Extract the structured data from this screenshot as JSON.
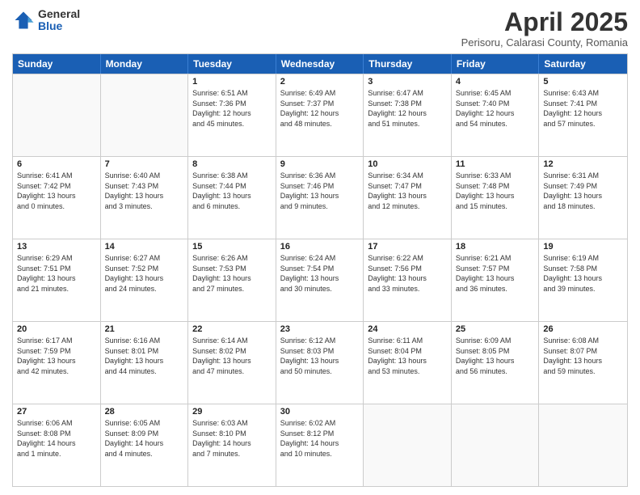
{
  "logo": {
    "general": "General",
    "blue": "Blue"
  },
  "header": {
    "title": "April 2025",
    "subtitle": "Perisoru, Calarasi County, Romania"
  },
  "days_of_week": [
    "Sunday",
    "Monday",
    "Tuesday",
    "Wednesday",
    "Thursday",
    "Friday",
    "Saturday"
  ],
  "rows": [
    [
      {
        "day": "",
        "lines": []
      },
      {
        "day": "",
        "lines": []
      },
      {
        "day": "1",
        "lines": [
          "Sunrise: 6:51 AM",
          "Sunset: 7:36 PM",
          "Daylight: 12 hours",
          "and 45 minutes."
        ]
      },
      {
        "day": "2",
        "lines": [
          "Sunrise: 6:49 AM",
          "Sunset: 7:37 PM",
          "Daylight: 12 hours",
          "and 48 minutes."
        ]
      },
      {
        "day": "3",
        "lines": [
          "Sunrise: 6:47 AM",
          "Sunset: 7:38 PM",
          "Daylight: 12 hours",
          "and 51 minutes."
        ]
      },
      {
        "day": "4",
        "lines": [
          "Sunrise: 6:45 AM",
          "Sunset: 7:40 PM",
          "Daylight: 12 hours",
          "and 54 minutes."
        ]
      },
      {
        "day": "5",
        "lines": [
          "Sunrise: 6:43 AM",
          "Sunset: 7:41 PM",
          "Daylight: 12 hours",
          "and 57 minutes."
        ]
      }
    ],
    [
      {
        "day": "6",
        "lines": [
          "Sunrise: 6:41 AM",
          "Sunset: 7:42 PM",
          "Daylight: 13 hours",
          "and 0 minutes."
        ]
      },
      {
        "day": "7",
        "lines": [
          "Sunrise: 6:40 AM",
          "Sunset: 7:43 PM",
          "Daylight: 13 hours",
          "and 3 minutes."
        ]
      },
      {
        "day": "8",
        "lines": [
          "Sunrise: 6:38 AM",
          "Sunset: 7:44 PM",
          "Daylight: 13 hours",
          "and 6 minutes."
        ]
      },
      {
        "day": "9",
        "lines": [
          "Sunrise: 6:36 AM",
          "Sunset: 7:46 PM",
          "Daylight: 13 hours",
          "and 9 minutes."
        ]
      },
      {
        "day": "10",
        "lines": [
          "Sunrise: 6:34 AM",
          "Sunset: 7:47 PM",
          "Daylight: 13 hours",
          "and 12 minutes."
        ]
      },
      {
        "day": "11",
        "lines": [
          "Sunrise: 6:33 AM",
          "Sunset: 7:48 PM",
          "Daylight: 13 hours",
          "and 15 minutes."
        ]
      },
      {
        "day": "12",
        "lines": [
          "Sunrise: 6:31 AM",
          "Sunset: 7:49 PM",
          "Daylight: 13 hours",
          "and 18 minutes."
        ]
      }
    ],
    [
      {
        "day": "13",
        "lines": [
          "Sunrise: 6:29 AM",
          "Sunset: 7:51 PM",
          "Daylight: 13 hours",
          "and 21 minutes."
        ]
      },
      {
        "day": "14",
        "lines": [
          "Sunrise: 6:27 AM",
          "Sunset: 7:52 PM",
          "Daylight: 13 hours",
          "and 24 minutes."
        ]
      },
      {
        "day": "15",
        "lines": [
          "Sunrise: 6:26 AM",
          "Sunset: 7:53 PM",
          "Daylight: 13 hours",
          "and 27 minutes."
        ]
      },
      {
        "day": "16",
        "lines": [
          "Sunrise: 6:24 AM",
          "Sunset: 7:54 PM",
          "Daylight: 13 hours",
          "and 30 minutes."
        ]
      },
      {
        "day": "17",
        "lines": [
          "Sunrise: 6:22 AM",
          "Sunset: 7:56 PM",
          "Daylight: 13 hours",
          "and 33 minutes."
        ]
      },
      {
        "day": "18",
        "lines": [
          "Sunrise: 6:21 AM",
          "Sunset: 7:57 PM",
          "Daylight: 13 hours",
          "and 36 minutes."
        ]
      },
      {
        "day": "19",
        "lines": [
          "Sunrise: 6:19 AM",
          "Sunset: 7:58 PM",
          "Daylight: 13 hours",
          "and 39 minutes."
        ]
      }
    ],
    [
      {
        "day": "20",
        "lines": [
          "Sunrise: 6:17 AM",
          "Sunset: 7:59 PM",
          "Daylight: 13 hours",
          "and 42 minutes."
        ]
      },
      {
        "day": "21",
        "lines": [
          "Sunrise: 6:16 AM",
          "Sunset: 8:01 PM",
          "Daylight: 13 hours",
          "and 44 minutes."
        ]
      },
      {
        "day": "22",
        "lines": [
          "Sunrise: 6:14 AM",
          "Sunset: 8:02 PM",
          "Daylight: 13 hours",
          "and 47 minutes."
        ]
      },
      {
        "day": "23",
        "lines": [
          "Sunrise: 6:12 AM",
          "Sunset: 8:03 PM",
          "Daylight: 13 hours",
          "and 50 minutes."
        ]
      },
      {
        "day": "24",
        "lines": [
          "Sunrise: 6:11 AM",
          "Sunset: 8:04 PM",
          "Daylight: 13 hours",
          "and 53 minutes."
        ]
      },
      {
        "day": "25",
        "lines": [
          "Sunrise: 6:09 AM",
          "Sunset: 8:05 PM",
          "Daylight: 13 hours",
          "and 56 minutes."
        ]
      },
      {
        "day": "26",
        "lines": [
          "Sunrise: 6:08 AM",
          "Sunset: 8:07 PM",
          "Daylight: 13 hours",
          "and 59 minutes."
        ]
      }
    ],
    [
      {
        "day": "27",
        "lines": [
          "Sunrise: 6:06 AM",
          "Sunset: 8:08 PM",
          "Daylight: 14 hours",
          "and 1 minute."
        ]
      },
      {
        "day": "28",
        "lines": [
          "Sunrise: 6:05 AM",
          "Sunset: 8:09 PM",
          "Daylight: 14 hours",
          "and 4 minutes."
        ]
      },
      {
        "day": "29",
        "lines": [
          "Sunrise: 6:03 AM",
          "Sunset: 8:10 PM",
          "Daylight: 14 hours",
          "and 7 minutes."
        ]
      },
      {
        "day": "30",
        "lines": [
          "Sunrise: 6:02 AM",
          "Sunset: 8:12 PM",
          "Daylight: 14 hours",
          "and 10 minutes."
        ]
      },
      {
        "day": "",
        "lines": []
      },
      {
        "day": "",
        "lines": []
      },
      {
        "day": "",
        "lines": []
      }
    ]
  ]
}
